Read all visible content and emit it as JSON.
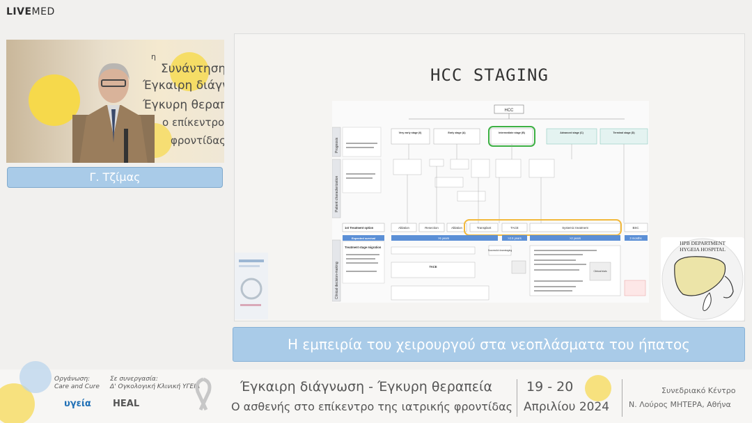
{
  "brand": {
    "live": "LIVE",
    "med": "MED"
  },
  "video": {
    "slide_lines": [
      "Συνάντηση",
      "Έγκαιρη διάγνωση -",
      "Έγκυρη θεραπεία",
      "ο επίκεντρο",
      "φροντίδας"
    ],
    "superscript": "η"
  },
  "speaker": {
    "name": "Γ. Τζίμας"
  },
  "slide": {
    "title": "HCC STAGING",
    "hpb_line1": "HPB DEPARTMENT",
    "hpb_line2": "HYGEIA HOSPITAL",
    "diagram": {
      "root": "HCC",
      "left_labels": [
        "Prognosis",
        "Patient characterization",
        "Clinical decision-making"
      ],
      "stages": [
        "Very early stage (0)",
        "Early stage (A)",
        "Intermediate stage (B)",
        "Advanced stage (C)",
        "Terminal stage (D)"
      ],
      "treatment_row_label": "1st Treatment option",
      "treatments": [
        "Ablation",
        "Resection",
        "Ablation",
        "Transplant",
        "TACE",
        "Systemic treatment",
        "BSC"
      ],
      "survival_label": "Expected survival",
      "survivals": [
        ">5 years",
        ">2.5 years",
        ">2 years",
        "3 months"
      ],
      "migration_label": "Treatment stage migration",
      "tace_box": "TACE",
      "downstaging": "Successful downstaging",
      "clinical_trials": "Clinical trials"
    }
  },
  "caption": {
    "text": "Η εμπειρία του χειρουργού στα νεοπλάσματα του ήπατος"
  },
  "footer": {
    "org_label": "Οργάνωση:",
    "org_name": "Care and Cure",
    "coop_label": "Σε συνεργασία:",
    "coop_name": "Δ' Ογκολογική Κλινική ΥΓΕΙΑ",
    "uyeia": "υγεία",
    "heal": "HEAL",
    "title1": "Έγκαιρη διάγνωση - Έγκυρη θεραπεία",
    "title2": "Ο ασθενής στο επίκεντρο της ιατρικής φροντίδας",
    "date1": "19 - 20",
    "date2": "Απριλίου 2024",
    "venue1": "Συνεδριακό Κέντρο",
    "venue2": "Ν. Λούρος ΜΗΤΕΡΑ, Αθήνα"
  },
  "colors": {
    "caption_bg": "#a9cbe8",
    "intermediate_highlight": "#3cb043",
    "treatment_highlight": "#f2b83a",
    "survival_bar": "#5b8fd6"
  }
}
